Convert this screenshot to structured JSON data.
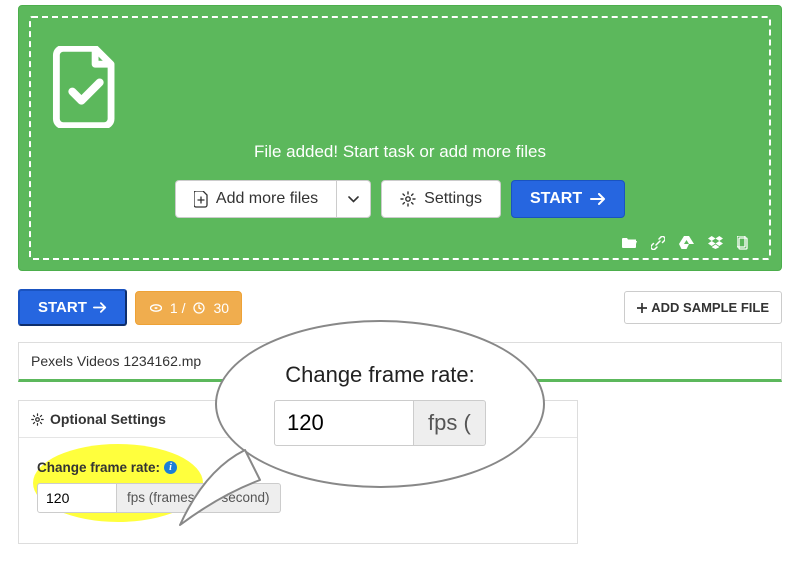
{
  "hero": {
    "message": "File added! Start task or add more files",
    "add_more_label": "Add more files",
    "settings_label": "Settings",
    "start_label": "START"
  },
  "action_bar": {
    "start_label": "START",
    "count": "1 / ",
    "size": "30",
    "sample_label": "ADD SAMPLE FILE"
  },
  "file": {
    "name": "Pexels Videos 1234162.mp"
  },
  "optional": {
    "title": "Optional Settings",
    "label": "Change frame rate:",
    "value": "120",
    "unit": "fps (frames per second)"
  },
  "callout": {
    "title": "Change frame rate:",
    "value": "120",
    "unit": "fps ("
  },
  "icons": {
    "file_ok": "file-check-icon",
    "add": "add-file-icon",
    "caret": "chevron-down-icon",
    "gear": "gear-icon",
    "arrow": "arrow-right-icon",
    "disc": "disc-icon",
    "clock": "clock-icon",
    "plus": "plus-icon",
    "folder": "folder-open-icon",
    "link": "link-icon",
    "gdrive": "google-drive-icon",
    "dropbox": "dropbox-icon",
    "clipboard": "clipboard-icon"
  }
}
